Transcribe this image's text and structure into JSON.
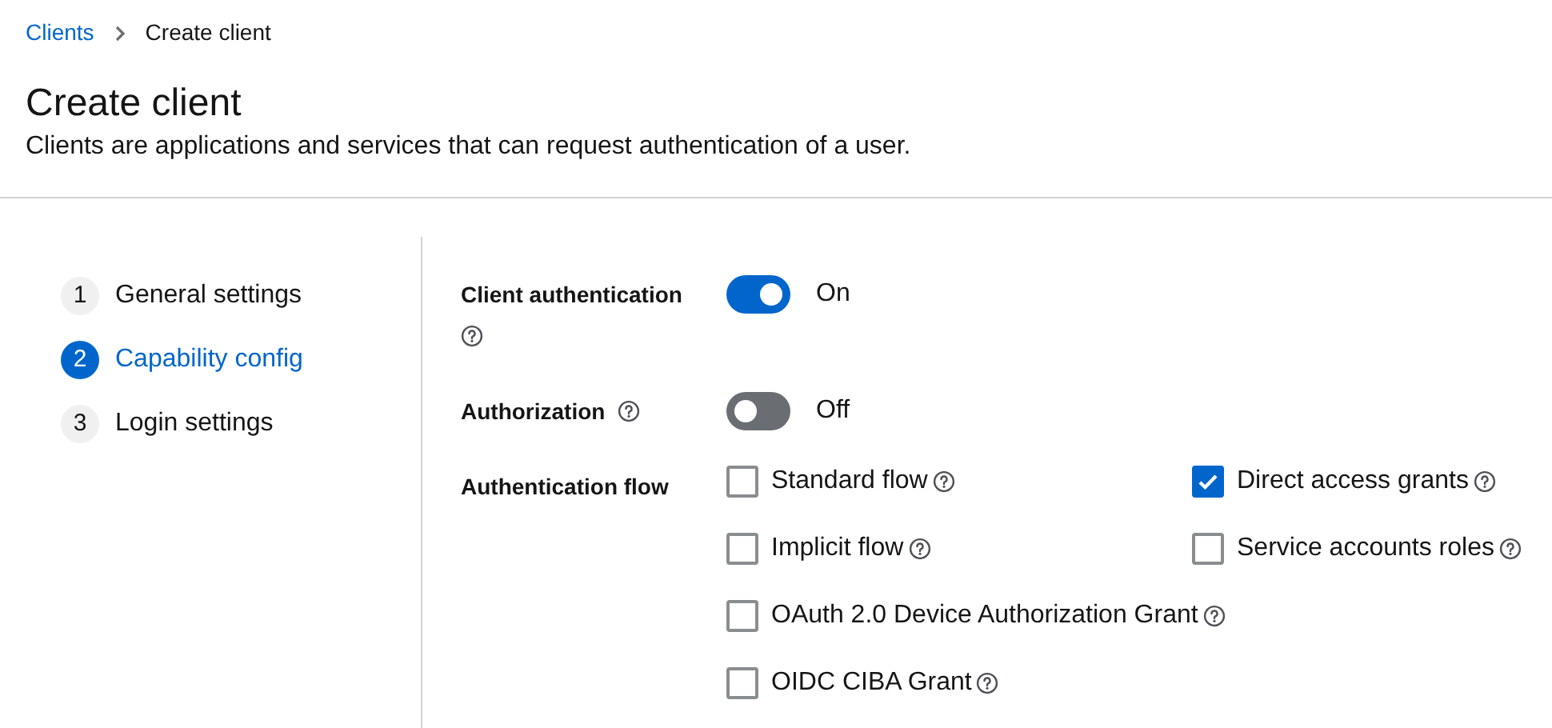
{
  "breadcrumb": [
    {
      "label": "Clients",
      "kind": "link"
    },
    {
      "label": "Create client",
      "kind": "current"
    }
  ],
  "page": {
    "title": "Create client",
    "description": "Clients are applications and services that can request authentication of a user."
  },
  "steps": [
    {
      "number": "1",
      "label": "General settings",
      "selected": false
    },
    {
      "number": "2",
      "label": "Capability config",
      "selected": true
    },
    {
      "number": "3",
      "label": "Login settings",
      "selected": false
    }
  ],
  "client_authentication": {
    "label": "Client authentication",
    "on": true,
    "state_text": "On"
  },
  "authorization": {
    "label": "Authorization",
    "on": false,
    "state_text": "Off"
  },
  "authentication_flow": {
    "label": "Authentication flow",
    "options": [
      {
        "label": "Standard flow",
        "checked": false
      },
      {
        "label": "Direct access grants",
        "checked": true
      },
      {
        "label": "Implicit flow",
        "checked": false
      },
      {
        "label": "Service accounts roles",
        "checked": false
      },
      {
        "label": "OAuth 2.0 Device Authorization Grant",
        "checked": false
      },
      {
        "label": "OIDC CIBA Grant",
        "checked": false
      }
    ]
  }
}
